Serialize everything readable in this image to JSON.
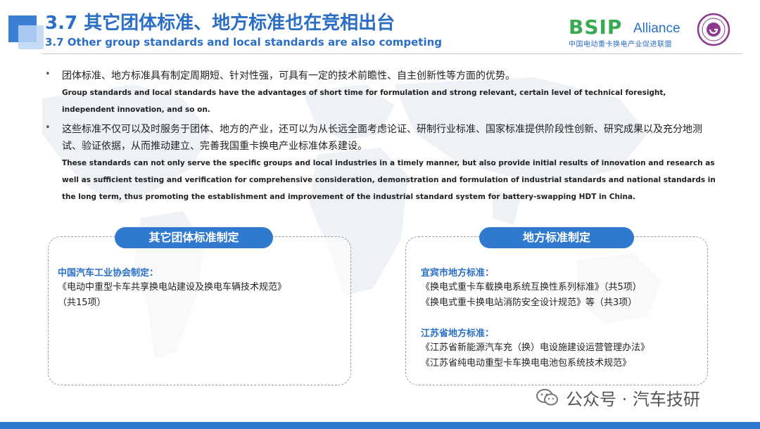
{
  "header": {
    "title_cn": "3.7 其它团体标准、地方标准也在竞相出台",
    "title_en": "3.7 Other group standards and local standards are also competing"
  },
  "logo": {
    "brand": "BSIP",
    "suffix": "Alliance",
    "subtitle": "中国电动重卡换电产业促进联盟"
  },
  "bullets": [
    {
      "cn": "团体标准、地方标准具有制定周期短、针对性强，可具有一定的技术前瞻性、自主创新性等方面的优势。",
      "en": "Group standards and local standards have the advantages of short time for formulation and strong relevant, certain level of technical foresight, independent innovation, and so on."
    },
    {
      "cn": "这些标准不仅可以及时服务于团体、地方的产业，还可以为从长远全面考虑论证、研制行业标准、国家标准提供阶段性创新、研究成果以及充分地测试、验证依据，从而推动建立、完善我国重卡换电产业标准体系建设。",
      "en": "These standards can not only serve the specific groups and local industries in a timely manner, but also provide initial results of innovation and research as well as sufficient testing and verification for comprehensive consideration, demonstration and formulation of industrial standards and national standards in the long term, thus promoting the establishment and improvement of the industrial standard system for battery-swapping HDT in China."
    }
  ],
  "left_panel": {
    "heading": "其它团体标准制定",
    "org": "中国汽车工业协会制定：",
    "items": [
      "《电动中重型卡车共享换电站建设及换电车辆技术规范》",
      "（共15项）"
    ]
  },
  "right_panel": {
    "heading": "地方标准制定",
    "groups": [
      {
        "org": "宜宾市地方标准：",
        "items": [
          "《换电式重卡车载换电系统互换性系列标准》（共5项）",
          "《换电式重卡换电站消防安全设计规范》等（共3项）"
        ]
      },
      {
        "org": "江苏省地方标准：",
        "items": [
          "《江苏省新能源汽车充（换）电设施建设运营管理办法》",
          "《江苏省纯电动重型卡车换电电池包系统技术规范》"
        ]
      }
    ]
  },
  "watermark": {
    "text": "公众号 · 汽车技研"
  },
  "colors": {
    "primary": "#2a6ec6",
    "pill": "#2f79cf",
    "brand_green": "#3aaa52"
  }
}
